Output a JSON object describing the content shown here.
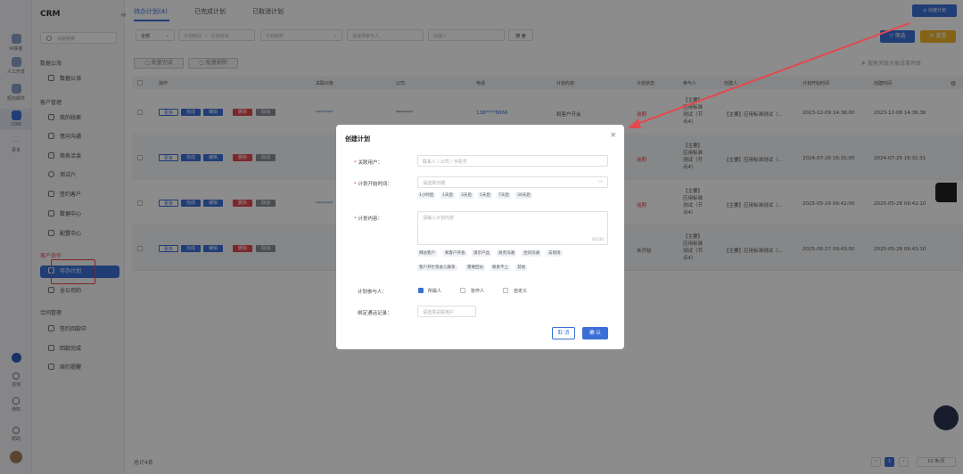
{
  "rail": {
    "items": [
      {
        "label": "AI获客"
      },
      {
        "label": "人工开发"
      },
      {
        "label": "短信邮件"
      },
      {
        "label": "CRM"
      },
      {
        "label": "更多"
      }
    ],
    "bottom": [
      {
        "label": "咨询"
      },
      {
        "label": "通知"
      },
      {
        "label": "帮助"
      }
    ]
  },
  "sidebar": {
    "app_title": "CRM",
    "search_placeholder": "功能搜索",
    "groups": [
      {
        "title": "数据公海",
        "items": [
          {
            "label": "数据公海"
          }
        ]
      },
      {
        "title": "客户管理",
        "items": [
          {
            "label": "我的线索"
          },
          {
            "label": "意向沟通"
          },
          {
            "label": "商务洽谈"
          },
          {
            "label": "测试六"
          },
          {
            "label": "签约客户"
          },
          {
            "label": "数据中心"
          },
          {
            "label": "配置中心"
          }
        ]
      },
      {
        "title": "客户协作",
        "items": [
          {
            "label": "待办计划"
          },
          {
            "label": "全公司的"
          }
        ]
      },
      {
        "title": "合同管理",
        "items": [
          {
            "label": "签约回款中"
          },
          {
            "label": "回款完成"
          },
          {
            "label": "续约提醒"
          }
        ]
      }
    ]
  },
  "tabs": [
    "待办计划(4)",
    "已完成计划",
    "已取消计划"
  ],
  "create_button": "创建计划",
  "filters": {
    "all": "全部",
    "start_placeholder": "计划时间",
    "range_sep": "~",
    "end_placeholder": "计划时间",
    "status_placeholder": "计划状态",
    "participant_placeholder": "请选择参与人",
    "creator_placeholder": "创建人",
    "search_button": "搜 索",
    "filter_button": "筛选",
    "reset_button": "重置"
  },
  "batch": {
    "complete": "批量完成",
    "delete": "批量删除"
  },
  "keyword_placeholder": "搜索关联对象或事件联",
  "table": {
    "headers": [
      "操作",
      "关联对象",
      "公司",
      "电话",
      "计划内容",
      "计划状态",
      "参与人",
      "创建人",
      "计划开始时间",
      "创建时间"
    ],
    "ops": [
      "更多",
      "完成",
      "编辑",
      "删除",
      "取消"
    ],
    "rows": [
      {
        "obj": "*******",
        "company": "*******",
        "phone": "138****8666",
        "content": "和客户开会",
        "status": "逾期",
        "participant": "【主要】\n应用标准\n测试（节\n点4）",
        "creator": "【主要】应用标准测试（...",
        "start": "2023-12-09 14:36:00",
        "created": "2023-12-08 14:36:36"
      },
      {
        "obj": "",
        "company": "",
        "phone": "",
        "content": "",
        "status": "逾期",
        "participant": "【主要】\n应用标准\n测试（节\n点4）",
        "creator": "【主要】应用标准测试（...",
        "start": "2024-07-26 16:31:00",
        "created": "2024-07-25 16:31:31"
      },
      {
        "obj": "*******",
        "company": "",
        "phone": "",
        "content": "",
        "status": "逾期",
        "participant": "【主要】\n应用标准\n测试（节\n点4）",
        "creator": "【主要】应用标准测试（...",
        "start": "2025-05-29 09:42:00",
        "created": "2025-05-28 09:42:10"
      },
      {
        "obj": "",
        "company": "",
        "phone": "",
        "content": "",
        "status": "未开始",
        "participant": "【主要】\n应用标准\n测试（节\n点4）",
        "creator": "【主要】应用标准测试（...",
        "start": "2025-06-27 09:43:00",
        "created": "2025-05-28 09:43:10"
      }
    ]
  },
  "footer": {
    "total": "总计4条",
    "page": "1",
    "page_size": "10 条/页"
  },
  "modal": {
    "title": "创建计划",
    "close": "×",
    "fields": {
      "user_label": "关联用户：",
      "user_placeholder": "联系人 / 公司 / 手机号",
      "time_label": "计划开始时间：",
      "time_placeholder": "请选择日期",
      "time_chips": [
        "1小时后",
        "1天后",
        "3天后",
        "5天后",
        "7天后",
        "30天后"
      ],
      "content_label": "计划内容：",
      "content_placeholder": "请输入计划内容",
      "content_count": "0/100",
      "content_chips": [
        "拜访客户",
        "和客户开会",
        "演示产品",
        "商务沟通",
        "合同沟通",
        "去现场",
        "客户开忙等会儿联系",
        "需要回访",
        "联系不上",
        "其他"
      ],
      "participant_label": "计划参与人：",
      "participant_options": [
        {
          "label": "所属人",
          "checked": true
        },
        {
          "label": "协作人",
          "checked": false
        },
        {
          "label": "自定义",
          "checked": false
        }
      ],
      "call_label": "绑定通话记录：",
      "call_placeholder": "请选择关联用户"
    },
    "cancel": "取 消",
    "confirm": "确 认"
  },
  "colors": {
    "primary": "#3b6fd8",
    "danger": "#e5484d",
    "gold": "#f0b429"
  }
}
